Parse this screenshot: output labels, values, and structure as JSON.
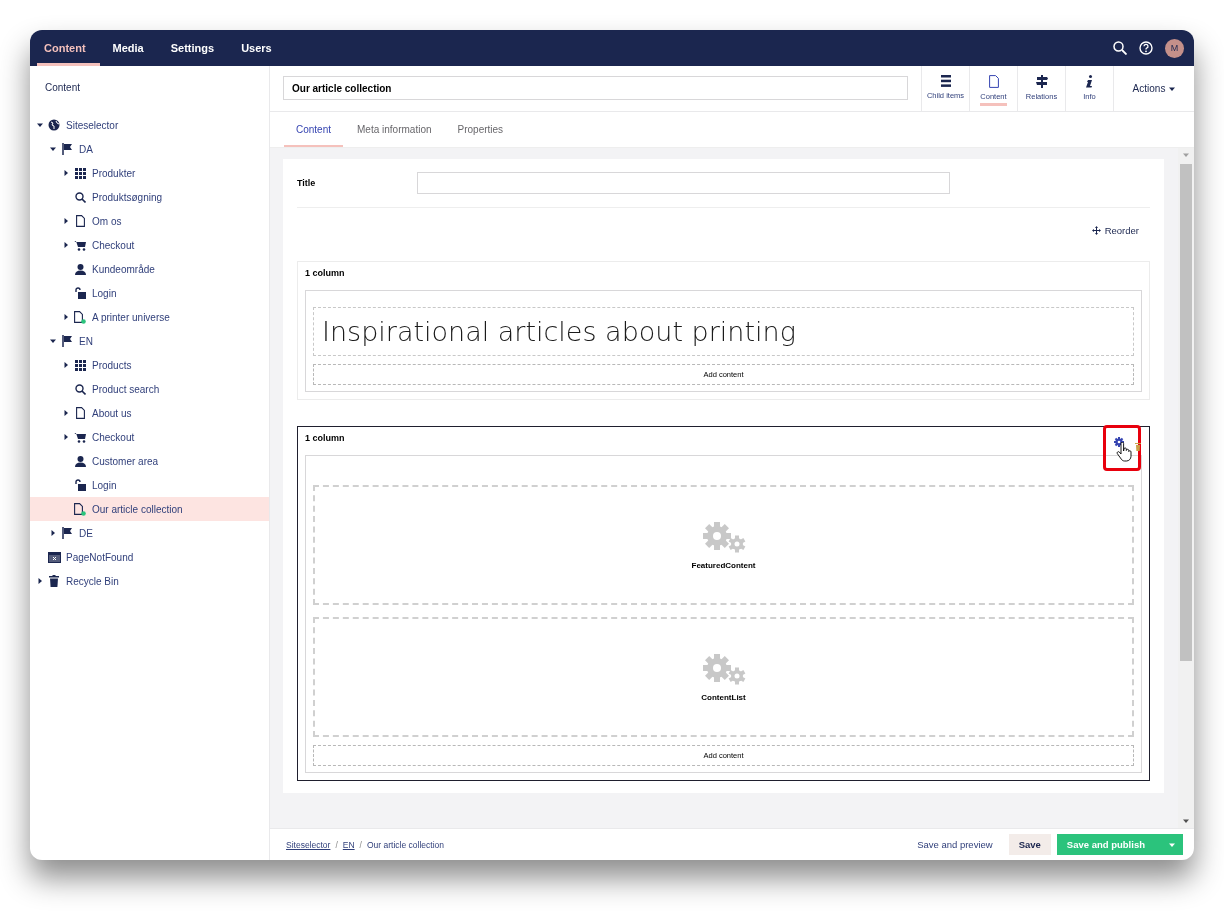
{
  "nav": {
    "sections": [
      {
        "label": "Content",
        "selected": true
      },
      {
        "label": "Media",
        "selected": false
      },
      {
        "label": "Settings",
        "selected": false
      },
      {
        "label": "Users",
        "selected": false
      }
    ],
    "avatar": "M"
  },
  "sidebar": {
    "title": "Content",
    "tree": [
      {
        "label": "Siteselector",
        "kind": "site",
        "expanded": true,
        "selected": false,
        "children": [
          {
            "label": "DA",
            "kind": "language",
            "expanded": true,
            "selected": false,
            "children": [
              {
                "label": "Produkter",
                "kind": "grid",
                "expanded": false,
                "selected": false
              },
              {
                "label": "Produktsøgning",
                "kind": "search",
                "selected": false
              },
              {
                "label": "Om os",
                "kind": "page",
                "expanded": false,
                "selected": false
              },
              {
                "label": "Checkout",
                "kind": "cart",
                "expanded": false,
                "selected": false
              },
              {
                "label": "Kundeområde",
                "kind": "user",
                "selected": false
              },
              {
                "label": "Login",
                "kind": "lock",
                "selected": false
              },
              {
                "label": "A printer universe",
                "kind": "new-page",
                "expanded": false,
                "selected": false
              }
            ]
          },
          {
            "label": "EN",
            "kind": "language",
            "expanded": true,
            "selected": false,
            "children": [
              {
                "label": "Products",
                "kind": "grid",
                "expanded": false,
                "selected": false
              },
              {
                "label": "Product search",
                "kind": "search",
                "selected": false
              },
              {
                "label": "About us",
                "kind": "page",
                "expanded": false,
                "selected": false
              },
              {
                "label": "Checkout",
                "kind": "cart",
                "expanded": false,
                "selected": false
              },
              {
                "label": "Customer area",
                "kind": "user",
                "selected": false
              },
              {
                "label": "Login",
                "kind": "lock",
                "selected": false
              },
              {
                "label": "Our article collection",
                "kind": "new-page",
                "selected": true
              }
            ]
          },
          {
            "label": "DE",
            "kind": "language",
            "expanded": false,
            "selected": false
          }
        ]
      },
      {
        "label": "PageNotFound",
        "kind": "error-page",
        "selected": false
      },
      {
        "label": "Recycle Bin",
        "kind": "bin",
        "expanded": false,
        "selected": false
      }
    ]
  },
  "editor": {
    "name": "Our article collection",
    "apps": [
      {
        "label": "Child items",
        "kind": "list",
        "selected": false
      },
      {
        "label": "Content",
        "kind": "document",
        "selected": true
      },
      {
        "label": "Relations",
        "kind": "signpost",
        "selected": false
      },
      {
        "label": "Info",
        "kind": "info",
        "selected": false
      }
    ],
    "actions": "Actions"
  },
  "tabs": [
    {
      "label": "Content",
      "selected": true
    },
    {
      "label": "Meta information",
      "selected": false
    },
    {
      "label": "Properties",
      "selected": false
    }
  ],
  "form": {
    "title_label": "Title",
    "reorder": "Reorder"
  },
  "grid_blocks": [
    {
      "label": "1 column",
      "active": false,
      "add_label": "Add content",
      "cells": [
        {
          "kind": "headline",
          "text": "Inspirational articles about printing"
        }
      ]
    },
    {
      "label": "1 column",
      "active": true,
      "add_label": "Add content",
      "cells": [
        {
          "kind": "macro",
          "text": "FeaturedContent"
        },
        {
          "kind": "macro",
          "text": "ContentList"
        }
      ]
    }
  ],
  "footer": {
    "separator": "/",
    "breadcrumbs": [
      {
        "label": "Siteselector",
        "link": true
      },
      {
        "label": "EN",
        "link": true
      },
      {
        "label": "Our article collection",
        "link": false
      }
    ],
    "preview": "Save and preview",
    "save": "Save",
    "publish": "Save and publish"
  }
}
